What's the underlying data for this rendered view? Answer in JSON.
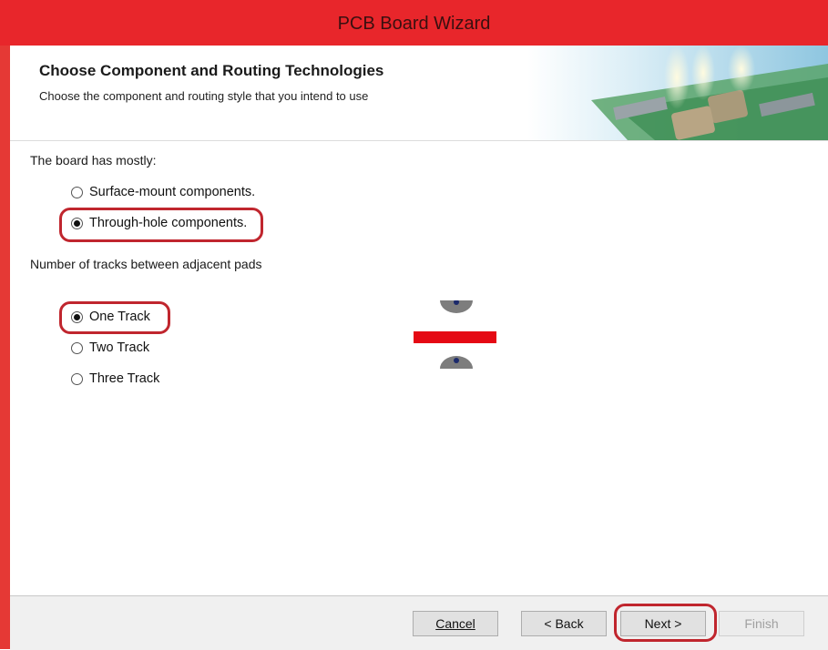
{
  "window": {
    "title": "PCB Board Wizard"
  },
  "header": {
    "title": "Choose Component and Routing Technologies",
    "subtitle": "Choose the component and routing style that you intend to use"
  },
  "components": {
    "label": "The board has mostly:",
    "options": [
      {
        "label": "Surface-mount components.",
        "checked": false
      },
      {
        "label": "Through-hole components.",
        "checked": true
      }
    ]
  },
  "tracks": {
    "label": "Number of tracks between adjacent pads",
    "options": [
      {
        "label": "One Track",
        "checked": true
      },
      {
        "label": "Two Track",
        "checked": false
      },
      {
        "label": "Three Track",
        "checked": false
      }
    ]
  },
  "buttons": {
    "cancel": "Cancel",
    "back": "< Back",
    "next": "Next >",
    "finish": "Finish"
  },
  "colors": {
    "titlebar": "#e8262b",
    "highlight": "#c0262e",
    "track": "#e50914"
  }
}
